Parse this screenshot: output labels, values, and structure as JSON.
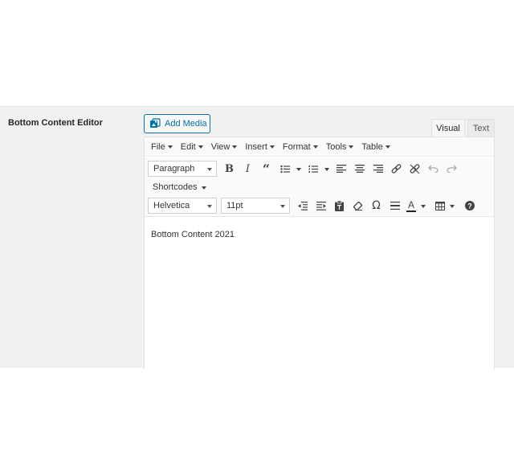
{
  "field": {
    "label": "Bottom Content Editor"
  },
  "add_media": {
    "label": "Add Media",
    "icon": "add-media-icon"
  },
  "tabs": [
    {
      "label": "Visual",
      "active": true
    },
    {
      "label": "Text",
      "active": false
    }
  ],
  "menubar": {
    "items": [
      {
        "label": "File"
      },
      {
        "label": "Edit"
      },
      {
        "label": "View"
      },
      {
        "label": "Insert"
      },
      {
        "label": "Format"
      },
      {
        "label": "Tools"
      },
      {
        "label": "Table"
      }
    ]
  },
  "toolbar1": {
    "format_select": "Paragraph",
    "buttons": [
      "bold-icon",
      "italic-icon",
      "blockquote-icon",
      "bullet-list-icon",
      "numbered-list-icon",
      "align-left-icon",
      "align-center-icon",
      "align-right-icon",
      "link-icon",
      "unlink-icon",
      "undo-icon",
      "redo-icon"
    ]
  },
  "toolbar2": {
    "shortcodes_label": "Shortcodes"
  },
  "toolbar3": {
    "font_family": "Helvetica",
    "font_size": "11pt",
    "buttons": [
      "outdent-icon",
      "indent-icon",
      "paste-as-text-icon",
      "clear-formatting-icon",
      "special-character-icon",
      "horizontal-line-icon",
      "text-color-icon",
      "table-icon",
      "help-icon"
    ],
    "text_color_letter": "A"
  },
  "content": {
    "text": "Bottom Content 2021"
  },
  "colors": {
    "accent": "#0073aa",
    "panel_bg": "#f1f1f1",
    "toolbar_bg": "#fafafa",
    "text": "#333333"
  }
}
